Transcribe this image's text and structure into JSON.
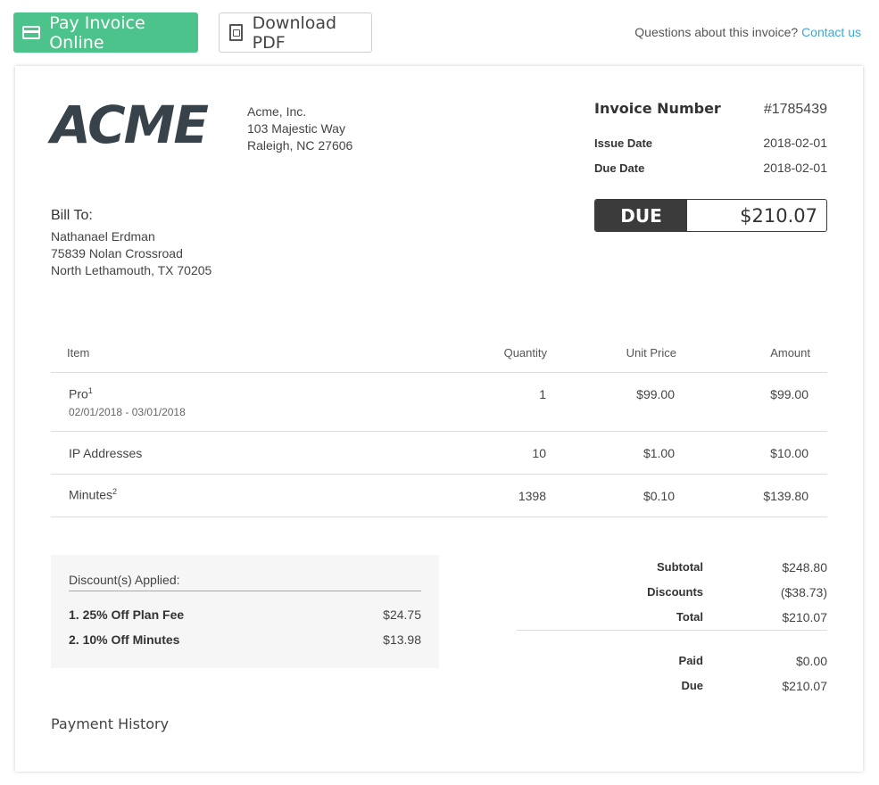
{
  "toolbar": {
    "pay_label": "Pay Invoice Online",
    "pdf_label": "Download PDF",
    "questions_text": "Questions about this invoice?",
    "contact_label": "Contact us"
  },
  "company": {
    "logo_text": "ACME",
    "name": "Acme, Inc.",
    "address1": "103 Majestic Way",
    "address2": "Raleigh, NC 27606"
  },
  "invoice": {
    "number_label": "Invoice Number",
    "number": "#1785439",
    "issue_label": "Issue Date",
    "issue_date": "2018-02-01",
    "due_label": "Due Date",
    "due_date": "2018-02-01",
    "due_badge": "DUE",
    "due_amount": "$210.07"
  },
  "bill_to": {
    "title": "Bill To:",
    "name": "Nathanael Erdman",
    "address1": "75839 Nolan Crossroad",
    "address2": "North Lethamouth, TX 70205"
  },
  "items": {
    "headers": {
      "item": "Item",
      "quantity": "Quantity",
      "unit_price": "Unit Price",
      "amount": "Amount"
    },
    "rows": [
      {
        "name": "Pro",
        "sup": "1",
        "period": "02/01/2018 - 03/01/2018",
        "quantity": "1",
        "unit_price": "$99.00",
        "amount": "$99.00"
      },
      {
        "name": "IP Addresses",
        "sup": "",
        "period": "",
        "quantity": "10",
        "unit_price": "$1.00",
        "amount": "$10.00"
      },
      {
        "name": "Minutes",
        "sup": "2",
        "period": "",
        "quantity": "1398",
        "unit_price": "$0.10",
        "amount": "$139.80"
      }
    ]
  },
  "discounts": {
    "title": "Discount(s) Applied:",
    "rows": [
      {
        "label": "1. 25% Off Plan Fee",
        "value": "$24.75"
      },
      {
        "label": "2. 10% Off Minutes",
        "value": "$13.98"
      }
    ]
  },
  "totals": {
    "subtotal_label": "Subtotal",
    "subtotal": "$248.80",
    "discounts_label": "Discounts",
    "discounts": "($38.73)",
    "total_label": "Total",
    "total": "$210.07",
    "paid_label": "Paid",
    "paid": "$0.00",
    "due_label": "Due",
    "due": "$210.07"
  },
  "payment_history": {
    "title": "Payment History"
  }
}
